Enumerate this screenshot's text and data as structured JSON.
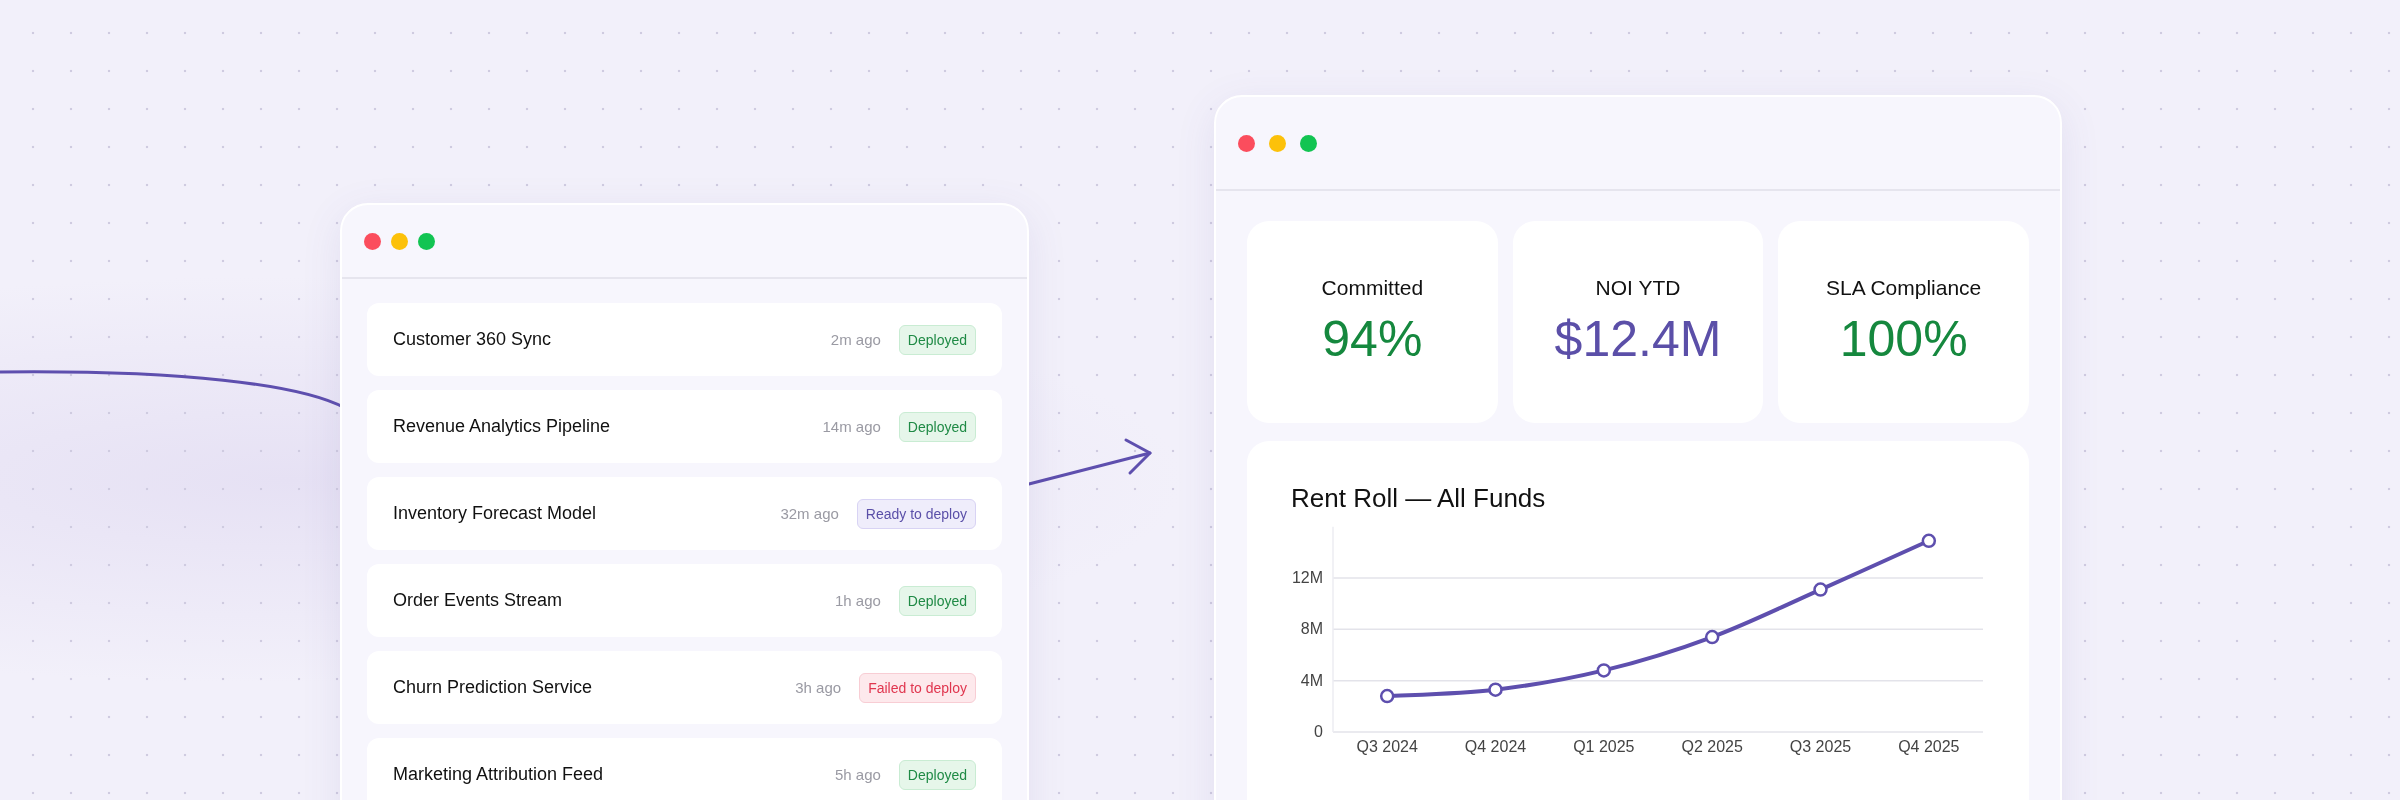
{
  "deployments": {
    "rows": [
      {
        "name": "Customer 360 Sync",
        "time": "2m ago",
        "status": "Deployed",
        "kind": "deployed"
      },
      {
        "name": "Revenue Analytics Pipeline",
        "time": "14m ago",
        "status": "Deployed",
        "kind": "deployed"
      },
      {
        "name": "Inventory Forecast Model",
        "time": "32m ago",
        "status": "Ready to deploy",
        "kind": "ready"
      },
      {
        "name": "Order Events Stream",
        "time": "1h ago",
        "status": "Deployed",
        "kind": "deployed"
      },
      {
        "name": "Churn Prediction Service",
        "time": "3h ago",
        "status": "Failed to deploy",
        "kind": "failed"
      },
      {
        "name": "Marketing Attribution Feed",
        "time": "5h ago",
        "status": "Deployed",
        "kind": "deployed"
      }
    ]
  },
  "dashboard": {
    "stats": [
      {
        "label": "Committed",
        "value": "94%",
        "color": "#15883e"
      },
      {
        "label": "NOI YTD",
        "value": "$12.4M",
        "color": "#5b4fa8"
      },
      {
        "label": "SLA Compliance",
        "value": "100%",
        "color": "#15883e"
      }
    ],
    "chart": {
      "title": "Rent Roll — All Funds",
      "chart_data": {
        "type": "line",
        "categories": [
          "Q3 2024",
          "Q4 2024",
          "Q1 2025",
          "Q2 2025",
          "Q3 2025",
          "Q4 2025"
        ],
        "series": [
          {
            "color": "#5e4fae",
            "marker": "circle",
            "values": [
              2.8,
              3.3,
              4.8,
              7.4,
              11.1,
              14.9
            ]
          }
        ],
        "grid": true,
        "ylim": [
          0,
          16
        ],
        "yticks": [
          {
            "value": 0,
            "label": "0"
          },
          {
            "value": 4,
            "label": "4M"
          },
          {
            "value": 8,
            "label": "8M"
          },
          {
            "value": 12,
            "label": "12M"
          }
        ]
      }
    }
  }
}
